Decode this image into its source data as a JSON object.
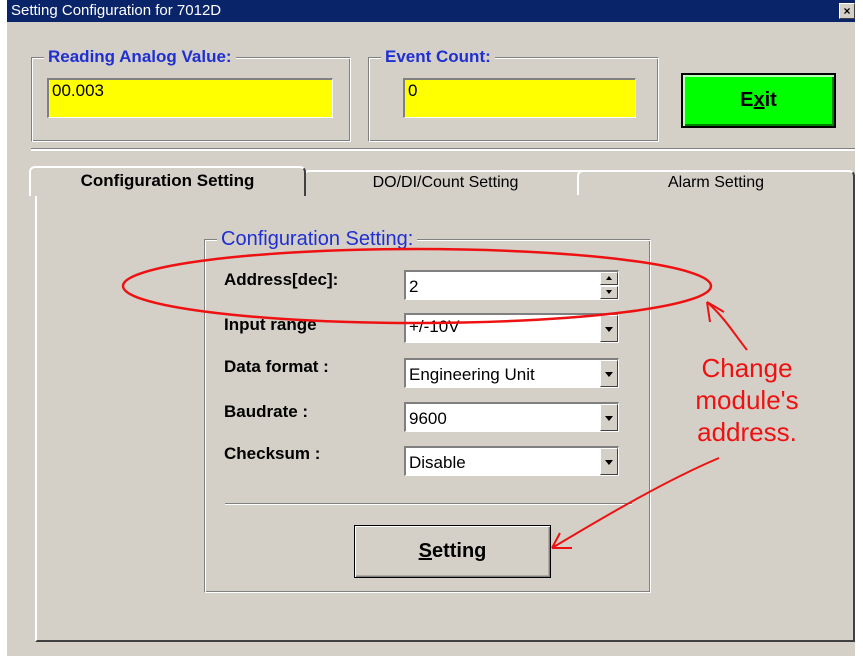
{
  "window": {
    "title": "Setting Configuration for 7012D",
    "close_glyph": "×"
  },
  "reading": {
    "label": "Reading  Analog Value:",
    "value": "00.003"
  },
  "event_count": {
    "label": "Event Count:",
    "value": "0"
  },
  "exit_button": {
    "label_pre": "E",
    "label_accel": "x",
    "label_post": "it"
  },
  "tabs": [
    {
      "label": "Configuration Setting",
      "active": true
    },
    {
      "label": "DO/DI/Count Setting",
      "active": false
    },
    {
      "label": "Alarm Setting",
      "active": false
    }
  ],
  "config": {
    "group_label": "Configuration Setting:",
    "address": {
      "label": "Address[dec]:",
      "value": "2"
    },
    "input_range": {
      "label": "Input range",
      "value": "+/-10V"
    },
    "data_format": {
      "label": "Data format :",
      "value": "Engineering Unit"
    },
    "baudrate": {
      "label": "Baudrate     :",
      "value": "9600"
    },
    "checksum": {
      "label": "Checksum   :",
      "value": "Disable"
    },
    "setting_button": {
      "label_accel": "S",
      "label_post": "etting"
    }
  },
  "annotation": {
    "line1": "Change",
    "line2": "module's",
    "line3": "address.",
    "color": "#ee1111"
  },
  "colors": {
    "title_bar": "#0a246a",
    "dialog_bg": "#d4d0c8",
    "label_blue": "#1f2fd1",
    "value_field": "#ffff00",
    "exit_button": "#00ff00"
  }
}
